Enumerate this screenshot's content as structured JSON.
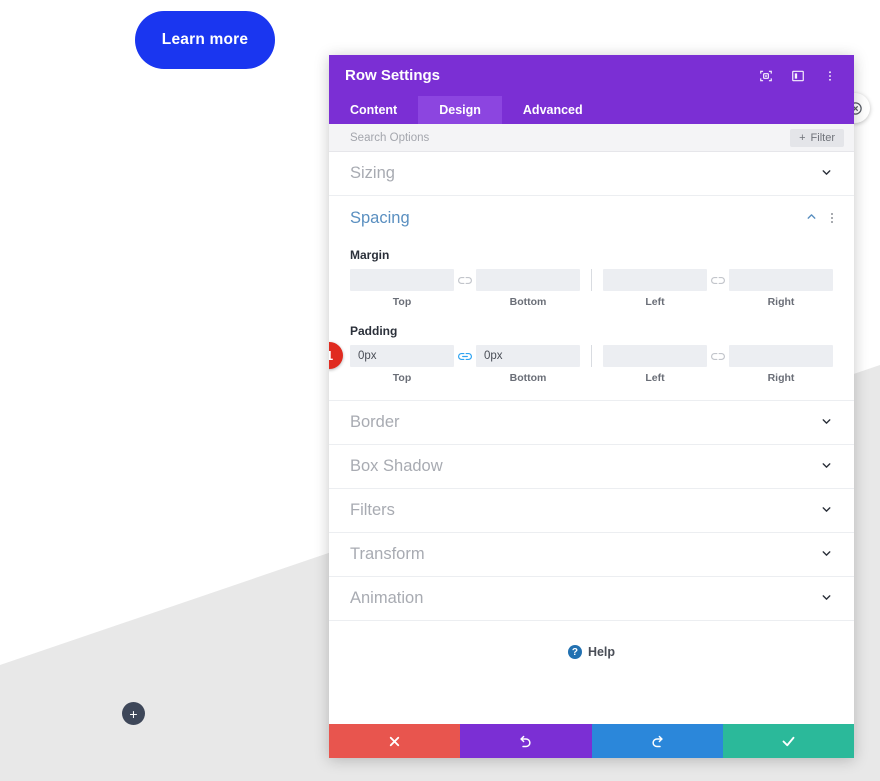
{
  "page": {
    "learn_more_label": "Learn more",
    "add_row_label": "+",
    "learn_more_color": "#1a36f0",
    "section_bg_color": "#e8e8e8"
  },
  "modal": {
    "title": "Row Settings",
    "header_color": "#7b2fd4",
    "active_tab_color": "#8c45e0",
    "header_icons": [
      {
        "name": "focus-target-icon"
      },
      {
        "name": "panel-layout-icon"
      },
      {
        "name": "more-vertical-icon"
      }
    ],
    "tabs": [
      {
        "label": "Content",
        "active": false
      },
      {
        "label": "Design",
        "active": true
      },
      {
        "label": "Advanced",
        "active": false
      }
    ],
    "search": {
      "placeholder": "Search Options",
      "value": "",
      "filter_label": "Filter",
      "filter_plus": "+"
    },
    "sections": [
      {
        "label": "Sizing",
        "expanded": false
      },
      {
        "label": "Spacing",
        "expanded": true
      },
      {
        "label": "Border",
        "expanded": false
      },
      {
        "label": "Box Shadow",
        "expanded": false
      },
      {
        "label": "Filters",
        "expanded": false
      },
      {
        "label": "Transform",
        "expanded": false
      },
      {
        "label": "Animation",
        "expanded": false
      }
    ],
    "spacing": {
      "title": "Spacing",
      "title_color": "#5a8fc0",
      "margin": {
        "label": "Margin",
        "top": {
          "value": "",
          "sub": "Top"
        },
        "bottom": {
          "value": "",
          "sub": "Bottom"
        },
        "left": {
          "value": "",
          "sub": "Left"
        },
        "right": {
          "value": "",
          "sub": "Right"
        },
        "link_top_bottom": false,
        "link_left_right": false
      },
      "padding": {
        "label": "Padding",
        "top": {
          "value": "0px",
          "sub": "Top"
        },
        "bottom": {
          "value": "0px",
          "sub": "Bottom"
        },
        "left": {
          "value": "",
          "sub": "Left"
        },
        "right": {
          "value": "",
          "sub": "Right"
        },
        "link_top_bottom": true,
        "link_left_right": false
      },
      "badge": "1",
      "badge_color": "#e02b20"
    },
    "help": {
      "label": "Help",
      "icon_char": "?"
    },
    "footer_buttons": [
      {
        "name": "discard-changes-button",
        "icon": "close",
        "color": "#e8554e"
      },
      {
        "name": "undo-button",
        "icon": "undo",
        "color": "#7b2fd4"
      },
      {
        "name": "redo-button",
        "icon": "redo",
        "color": "#2b87da"
      },
      {
        "name": "save-changes-button",
        "icon": "check",
        "color": "#2bb99a"
      }
    ]
  }
}
